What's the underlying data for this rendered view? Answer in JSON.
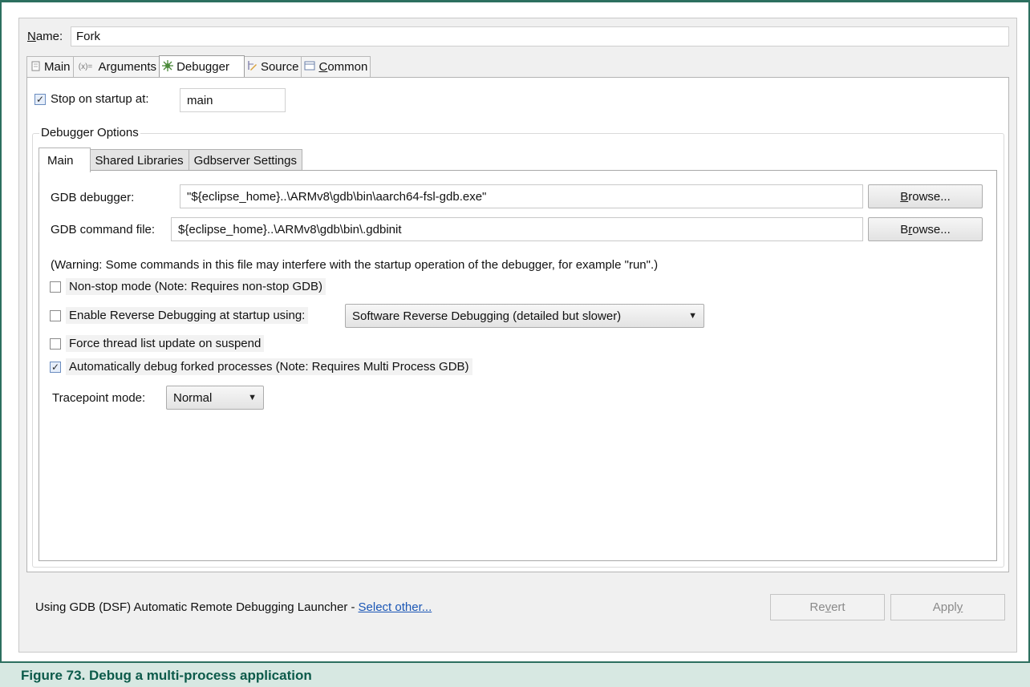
{
  "name": {
    "label_prefix": "N",
    "label_rest": "ame:",
    "value": "Fork"
  },
  "outer_tabs": [
    {
      "icon": "document-icon",
      "label": "Main"
    },
    {
      "icon": "arguments-icon",
      "icon_text": "(x)=",
      "label": "Arguments"
    },
    {
      "icon": "debugger-bug-icon",
      "label": "Debugger",
      "active": true
    },
    {
      "icon": "source-icon",
      "label": "Source"
    },
    {
      "icon": "common-icon",
      "label_prefix": "C",
      "label_rest": "ommon"
    }
  ],
  "stop_on_startup": {
    "label": "Stop on startup at:",
    "checked": true,
    "value": "main"
  },
  "debugger_options": {
    "group_label": "Debugger Options",
    "tabs": [
      "Main",
      "Shared Libraries",
      "Gdbserver Settings"
    ],
    "gdb_debugger": {
      "label": "GDB debugger:",
      "value": "\"${eclipse_home}..\\ARMv8\\gdb\\bin\\aarch64-fsl-gdb.exe\"",
      "browse_prefix": "B",
      "browse_rest": "rowse..."
    },
    "gdb_command_file": {
      "label": "GDB command file:",
      "value": "${eclipse_home}..\\ARMv8\\gdb\\bin\\.gdbinit",
      "browse_prefix": "B",
      "browse_mid": "r",
      "browse_rest": "owse..."
    },
    "warning": "(Warning: Some commands in this file may interfere with the startup operation of the debugger, for example \"run\".)",
    "options": [
      {
        "label": "Non-stop mode (Note: Requires non-stop GDB)",
        "checked": false
      },
      {
        "label": "Enable Reverse Debugging at startup using:",
        "checked": false
      },
      {
        "label": "Force thread list update on suspend",
        "checked": false
      },
      {
        "label": "Automatically debug forked processes (Note: Requires Multi Process GDB)",
        "checked": true
      }
    ],
    "reverse_mode": "Software Reverse Debugging (detailed but slower)",
    "tracepoint": {
      "label": "Tracepoint mode:",
      "value": "Normal"
    }
  },
  "footer": {
    "launcher_text": "Using GDB (DSF) Automatic Remote Debugging Launcher -",
    "select_other": "Select other...",
    "revert_a": "Re",
    "revert_u": "v",
    "revert_b": "ert",
    "apply_a": "Appl",
    "apply_u": "y"
  },
  "caption": "Figure 73.  Debug a multi-process application",
  "colors": {
    "caption_bg": "#d7e8e2",
    "caption_text": "#0c5a4a",
    "link": "#1a56b5",
    "frame": "#2c6f5f"
  }
}
